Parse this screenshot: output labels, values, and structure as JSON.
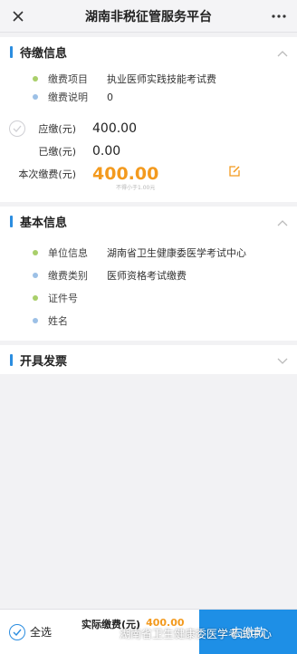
{
  "header": {
    "title": "湖南非税征管服务平台"
  },
  "pending": {
    "title": "待缴信息",
    "items": [
      {
        "label": "缴费项目",
        "value": "执业医师实践技能考试费",
        "dot": "green"
      },
      {
        "label": "缴费说明",
        "value": "0",
        "dot": "blue"
      }
    ],
    "due_label": "应缴(元)",
    "due_value": "400.00",
    "paid_label": "已缴(元)",
    "paid_value": "0.00",
    "current_label": "本次缴费(元)",
    "current_value": "400.00",
    "hint": "不得小于1.00元"
  },
  "basic": {
    "title": "基本信息",
    "items": [
      {
        "label": "单位信息",
        "value": "湖南省卫生健康委医学考试中心",
        "dot": "green"
      },
      {
        "label": "缴费类别",
        "value": "医师资格考试缴费",
        "dot": "blue"
      },
      {
        "label": "证件号",
        "value": "",
        "dot": "green"
      },
      {
        "label": "姓名",
        "value": "",
        "dot": "blue"
      }
    ]
  },
  "invoice": {
    "title": "开具发票"
  },
  "footer": {
    "select_all": "全选",
    "total_label": "实际缴费(元)",
    "total_value": "400.00",
    "pay_button": "去缴款"
  },
  "watermark": "湖南省卫生健康委医学考试中心",
  "colors": {
    "accent": "#2b8de0",
    "amount": "#f39a1e",
    "pay_button": "#1e8fe6"
  }
}
